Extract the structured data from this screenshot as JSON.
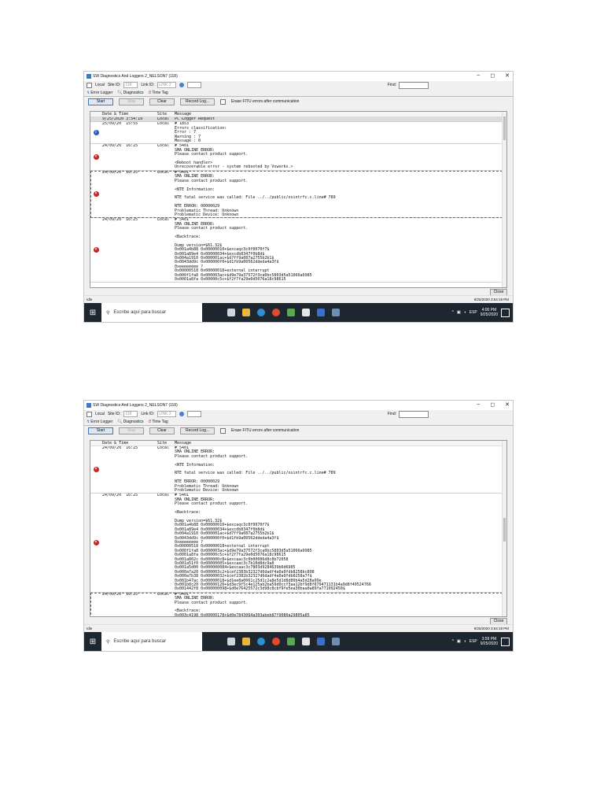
{
  "app": {
    "title": "SW Diagnostics And Loggers 2_NELSON7 (118)",
    "window_controls": [
      "–",
      "◻",
      "✕"
    ],
    "local_label": "Local",
    "site_id_label": "Site ID:",
    "site_id_value": "118",
    "link_id_label": "Link ID:",
    "link_id_value": "LINK 2",
    "find_label": "Find:",
    "tabs": [
      {
        "icon": "error-logger-icon",
        "label": "Error Logger"
      },
      {
        "icon": "diagnostics-icon",
        "label": "Diagnostics"
      },
      {
        "icon": "time-tag-icon",
        "label": "Time Tag"
      }
    ],
    "buttons": {
      "start": "Start",
      "stop": "Stop",
      "clear": "Clear",
      "record": "Record Log..."
    },
    "erase_label": "Erase FITU errors after communication",
    "columns": [
      "Date & Time",
      "Site",
      "Message"
    ],
    "close_label": "Close",
    "status_text": "Idle",
    "taskbar": {
      "search_placeholder": "Escribe aquí para buscar",
      "lang": "ESP"
    }
  },
  "screens": [
    {
      "status_time": "9/25/2020 3:54:19 PM",
      "clock_time": "4:00 PM",
      "clock_date": "9/25/2020",
      "rows": [
        {
          "date": "9/25/2020 3:54:19",
          "site": "Local",
          "icon": "",
          "selected": true,
          "message": "PC Logger Request"
        },
        {
          "date": "25/09/20  15:55",
          "site": "Local",
          "icon": "info",
          "message": "# 1853\nErrors classification:\nError : 7\nWarning : 7\nMessage : 0"
        },
        {
          "date": "24/09/20  16:25",
          "site": "Local",
          "icon": "error",
          "message": "# 5401\nSMA ONLINE ERROR:\nPlease contact product support.\n\n<Reboot handler>\nUnrecoverable error - system rebooted by Vxworks.>"
        },
        {
          "date": "24/09/20  16:25",
          "site": "Local",
          "icon": "error",
          "dashed": true,
          "message": "# 5401\nSMA ONLINE ERROR:\nPlease contact product support.\n\n<NTE Information:\n\nNTE fatal service was called: File ../../public/osintrfc.c.line# 789\n\nNTE ERROR: 00000029\nProblematic Thread: Unknown\nProblematic Device: Unknown"
        },
        {
          "date": "24/09/20  16:25",
          "site": "Local",
          "icon": "error",
          "message": "# 5401\nSMA ONLINE ERROR:\nPlease contact product support.\n\n<Backtrace:\n\nDump version=$61.32$\n0x001a4b88 0x00000010+$excaqc3c0f0070f7$\n0x001a89e4 0x00000034+$excdb8347f0b8d$\n0x004a1910 0x000001ac+$d7ff9a087a2755b2b1$\n0x0043dd9c 0x000000f0+$d1fb9a00562ddeda4a3f$\n0xeeeeeeee ?\n0x00000518 0x00000018+external interrupt\n0x000f1fa8 0x000003ac+$d9e79a37572f3ca0bc5803d5a51066a0985\n0x0001a8fa 0x00000c5c+$f2f7fa29e0d5076a18c98615"
        }
      ]
    },
    {
      "status_time": "9/25/2020 3:54:19 PM",
      "clock_time": "3:59 PM",
      "clock_date": "9/25/2020",
      "rows": [
        {
          "date": "24/09/20  16:25",
          "site": "Local",
          "icon": "error",
          "message": "# 5401\nSMA ONLINE ERROR:\nPlease contact product support.\n\n<NTE Information:\n\nNTE fatal service was called: File ../../public/osintrfc.c.line# 789\n\nNTE ERROR: 00000029\nProblematic Thread: Unknown\nProblematic Device: Unknown"
        },
        {
          "date": "24/09/20  16:25",
          "site": "Local",
          "icon": "error",
          "message": "# 5401\nSMA ONLINE ERROR:\nPlease contact product support.\n\n<Backtrace:\n\nDump version=$61.32$\n0x001a4b88 0x00000010+$excaqc3c0f0070f7$\n0x001a89e4 0x00000034+$excdb8347f0b8d$\n0x004a1910 0x000001ac+$d7ff9a087a2755b2b1$\n0x0043dd9c 0x000000f0+$d1fb9a00562ddeda4a3f$\n0xeeeeeeee ?\n0x00000518 0x00000018+external interrupt\n0x000f1fa8 0x000003ac+$d9e79a37572f3ca0bc5803d5a51066a0985\n0x0001a8fa 0x00000c5c+$f2f7fa29e0d5076a18c98615\n0x001a802c 0x000000c8+$excaac3c0b00086d8c8b72058\n0x001a51f0 0x00000005+$excaac3c7b10d8dc9a8\n0x001a5d00 0x000000084+$excaac3c7803d9284639b6d6985\n0x000a7a20 0x000003c2+$cef2383b32327d6dadf4a0a9fdb8258bc898\n0x000a7b38 0x00000032+$cef2382b32327d6dadf4a0a9fdb8258a7f$\n0x001b47ac 0x00000018+$d1ee8a0061c25d1c2a8e5d1d8d80b4a5d28a99e\n0x001b8c20 0x00000120+$d3ec9f5c4e125ab2ba59d0ccf3aa12bf9d8f679471131b4a9d8f40524766\n0x001442f8 0x000000098+$d0e76425572c3d98c8cbf9fe5ea30baa0a89fa771092450$"
        },
        {
          "date": "24/09/20  16:25",
          "site": "Local",
          "icon": "",
          "dashed": true,
          "message": "# 5401\nSMA ONLINE ERROR:\nPlease contact product support.\n\n<Backtrace:\n0x003c4198 0x00000178+$d0e7843064a303abeb87f9080a29805a85"
        }
      ]
    }
  ]
}
